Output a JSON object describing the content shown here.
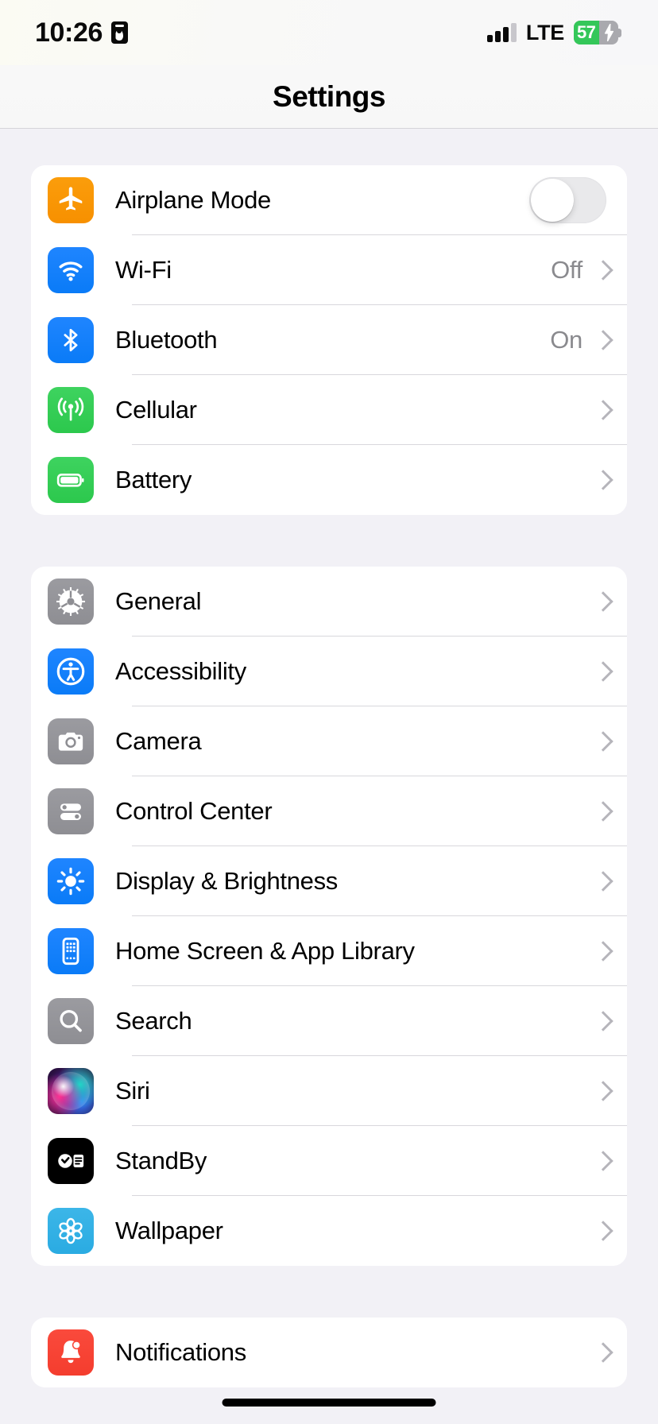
{
  "status_bar": {
    "time": "10:26",
    "left_icon": "id-card-icon",
    "signal_bars_filled": 3,
    "signal_bars_total": 4,
    "carrier": "LTE",
    "battery_percent": "57",
    "battery_level": 57,
    "battery_charging": true,
    "battery_color": "#34c759"
  },
  "nav": {
    "title": "Settings"
  },
  "groups": [
    {
      "id": "connectivity",
      "rows": [
        {
          "label": "Airplane Mode",
          "icon": "airplane-icon",
          "icon_class": "ic-airplane",
          "accessory": "toggle",
          "toggle_on": false
        },
        {
          "label": "Wi-Fi",
          "icon": "wifi-icon",
          "icon_class": "ic-wifi",
          "accessory": "value",
          "value": "Off"
        },
        {
          "label": "Bluetooth",
          "icon": "bluetooth-icon",
          "icon_class": "ic-bt",
          "accessory": "value",
          "value": "On"
        },
        {
          "label": "Cellular",
          "icon": "cellular-icon",
          "icon_class": "ic-cell",
          "accessory": "chevron",
          "value": ""
        },
        {
          "label": "Battery",
          "icon": "battery-icon",
          "icon_class": "ic-batt",
          "accessory": "chevron",
          "value": ""
        }
      ]
    },
    {
      "id": "system",
      "rows": [
        {
          "label": "General",
          "icon": "gear-icon",
          "icon_class": "ic-gray",
          "accessory": "chevron",
          "value": ""
        },
        {
          "label": "Accessibility",
          "icon": "accessibility-icon",
          "icon_class": "ic-blue",
          "accessory": "chevron",
          "value": ""
        },
        {
          "label": "Camera",
          "icon": "camera-icon",
          "icon_class": "ic-gray",
          "accessory": "chevron",
          "value": ""
        },
        {
          "label": "Control Center",
          "icon": "control-center-icon",
          "icon_class": "ic-gray",
          "accessory": "chevron",
          "value": ""
        },
        {
          "label": "Display & Brightness",
          "icon": "brightness-icon",
          "icon_class": "ic-blue",
          "accessory": "chevron",
          "value": ""
        },
        {
          "label": "Home Screen & App Library",
          "icon": "home-screen-icon",
          "icon_class": "ic-blue",
          "accessory": "chevron",
          "value": ""
        },
        {
          "label": "Search",
          "icon": "search-icon",
          "icon_class": "ic-gray",
          "accessory": "chevron",
          "value": ""
        },
        {
          "label": "Siri",
          "icon": "siri-icon",
          "icon_class": "ic-siri",
          "accessory": "chevron",
          "value": ""
        },
        {
          "label": "StandBy",
          "icon": "standby-icon",
          "icon_class": "ic-black",
          "accessory": "chevron",
          "value": ""
        },
        {
          "label": "Wallpaper",
          "icon": "wallpaper-icon",
          "icon_class": "ic-cyan",
          "accessory": "chevron",
          "value": ""
        }
      ]
    },
    {
      "id": "notifications",
      "rows": [
        {
          "label": "Notifications",
          "icon": "notifications-bell-icon",
          "icon_class": "ic-red",
          "accessory": "chevron",
          "value": ""
        }
      ]
    }
  ]
}
